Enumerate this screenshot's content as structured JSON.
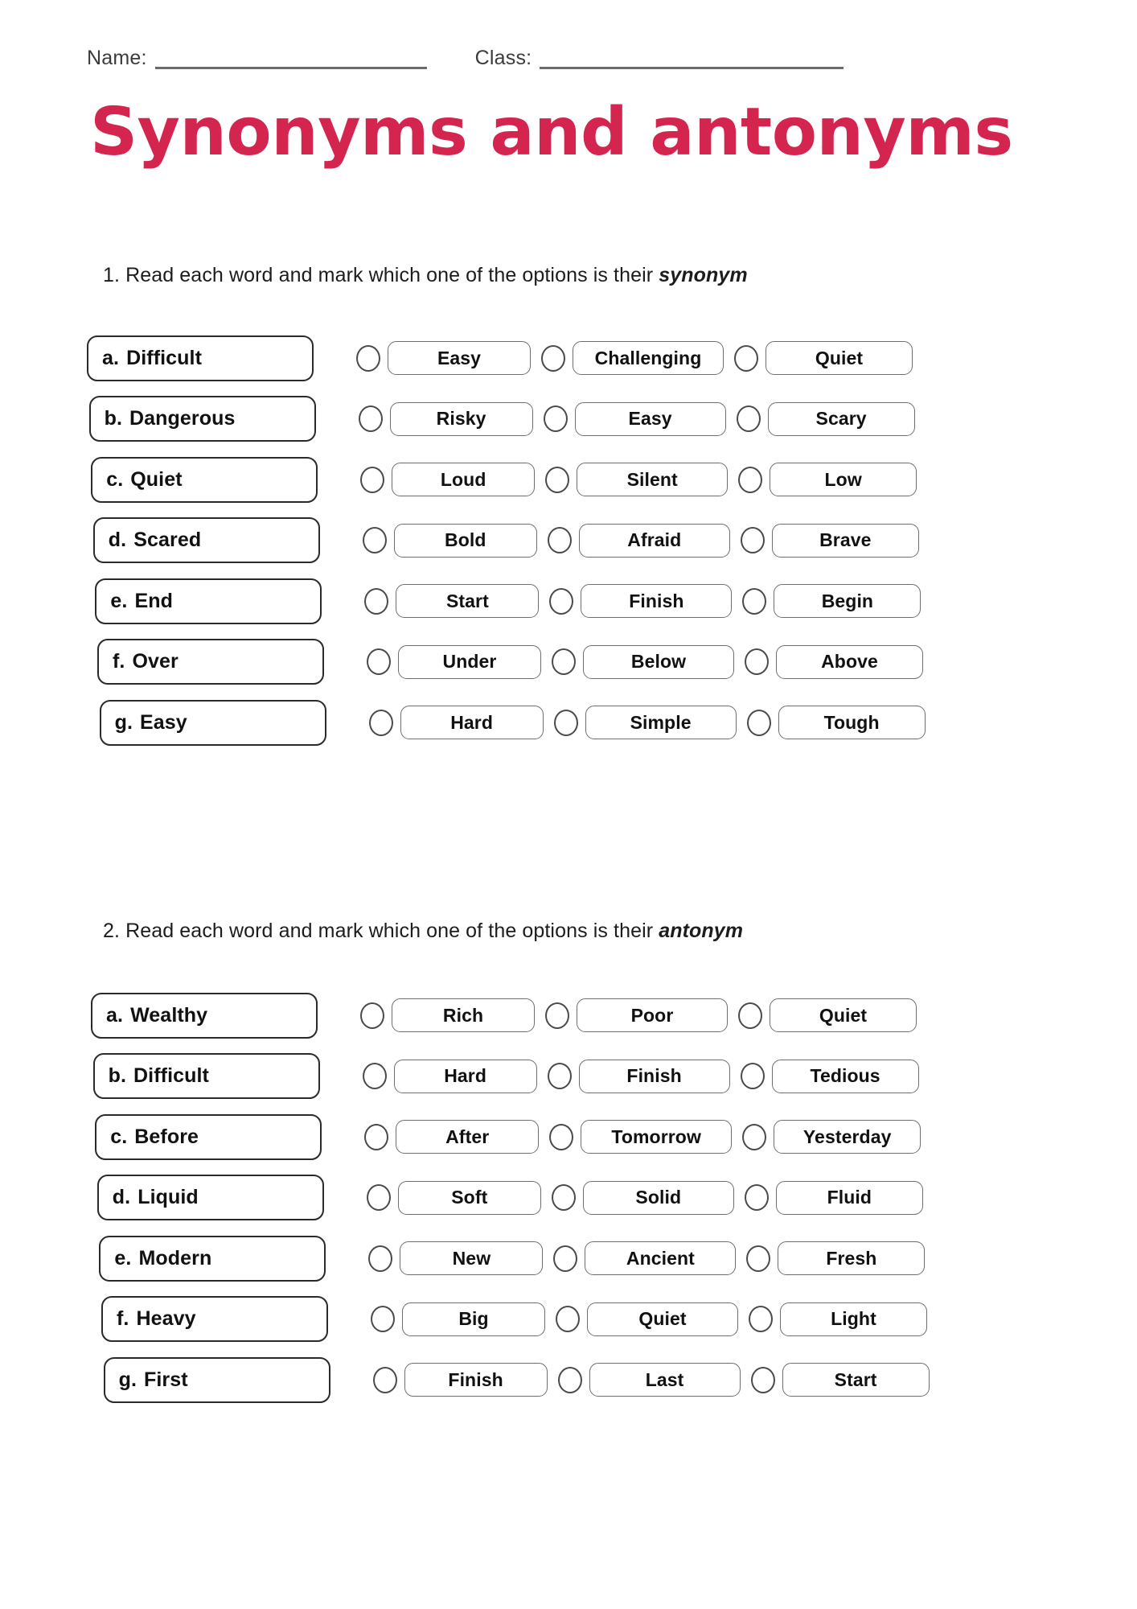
{
  "header": {
    "name_label": "Name:",
    "class_label": "Class:"
  },
  "title": "Synonyms and antonyms",
  "theme": {
    "title_color": "#D4254F",
    "text_color": "#111111",
    "box_border": "#2a2a2a",
    "option_border": "#6d6d6d",
    "rule_color": "#6b6b6b"
  },
  "sections": [
    {
      "number": "1.",
      "instruction_prefix": "1. Read each word and mark which one of the options is their ",
      "instruction_emphasis": "synonym",
      "rows": [
        {
          "letter": "a.",
          "word": "Difficult",
          "options": [
            "Easy",
            "Challenging",
            "Quiet"
          ]
        },
        {
          "letter": "b.",
          "word": "Dangerous",
          "options": [
            "Risky",
            "Easy",
            "Scary"
          ]
        },
        {
          "letter": "c.",
          "word": "Quiet",
          "options": [
            "Loud",
            "Silent",
            "Low"
          ]
        },
        {
          "letter": "d.",
          "word": "Scared",
          "options": [
            "Bold",
            "Afraid",
            "Brave"
          ]
        },
        {
          "letter": "e.",
          "word": "End",
          "options": [
            "Start",
            "Finish",
            "Begin"
          ]
        },
        {
          "letter": "f.",
          "word": "Over",
          "options": [
            "Under",
            "Below",
            "Above"
          ]
        },
        {
          "letter": "g.",
          "word": "Easy",
          "options": [
            "Hard",
            "Simple",
            "Tough"
          ]
        }
      ]
    },
    {
      "number": "2.",
      "instruction_prefix": "2. Read each word and mark which one of the options is their ",
      "instruction_emphasis": "antonym",
      "rows": [
        {
          "letter": "a.",
          "word": "Wealthy",
          "options": [
            "Rich",
            "Poor",
            "Quiet"
          ]
        },
        {
          "letter": "b.",
          "word": "Difficult",
          "options": [
            "Hard",
            "Finish",
            "Tedious"
          ]
        },
        {
          "letter": "c.",
          "word": "Before",
          "options": [
            "After",
            "Tomorrow",
            "Yesterday"
          ]
        },
        {
          "letter": "d.",
          "word": "Liquid",
          "options": [
            "Soft",
            "Solid",
            "Fluid"
          ]
        },
        {
          "letter": "e.",
          "word": "Modern",
          "options": [
            "New",
            "Ancient",
            "Fresh"
          ]
        },
        {
          "letter": "f.",
          "word": "Heavy",
          "options": [
            "Big",
            "Quiet",
            "Light"
          ]
        },
        {
          "letter": "g.",
          "word": "First",
          "options": [
            "Finish",
            "Last",
            "Start"
          ]
        }
      ]
    }
  ]
}
